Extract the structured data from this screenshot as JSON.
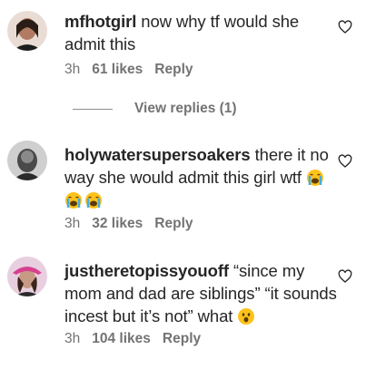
{
  "comments": [
    {
      "username": "mfhotgirl",
      "text": "now why tf would she admit this",
      "time": "3h",
      "likes": "61 likes",
      "reply_label": "Reply",
      "icon": "heart-outline-icon"
    },
    {
      "username": "holywatersupersoakers",
      "text": "there it no way she would admit this girl wtf",
      "time": "3h",
      "likes": "32 likes",
      "reply_label": "Reply",
      "icon": "heart-outline-icon"
    },
    {
      "username": "justheretopissyouoff",
      "text": "“since my mom and dad are siblings” “it sounds incest but it’s not” what",
      "time": "3h",
      "likes": "104 likes",
      "reply_label": "Reply",
      "icon": "heart-outline-icon"
    }
  ],
  "view_replies": "View replies (1)",
  "colors": {
    "text": "#262626",
    "secondary": "#737373"
  }
}
